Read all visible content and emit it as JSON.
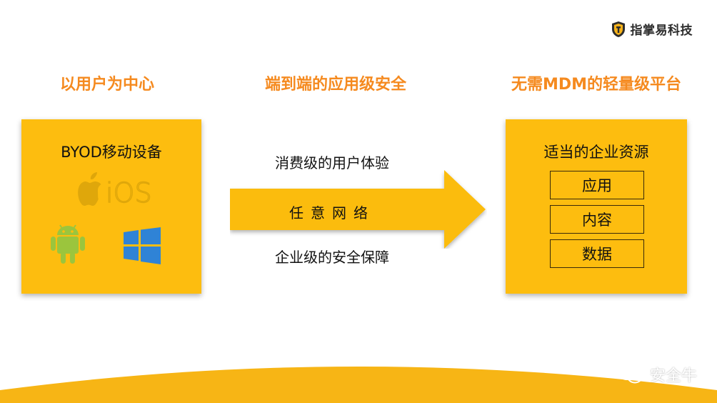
{
  "brand": {
    "name": "指掌易科技",
    "icon": "shield-logo-icon"
  },
  "headings": {
    "left": "以用户为中心",
    "center": "端到端的应用级安全",
    "right": "无需MDM的轻量级平台"
  },
  "left_box": {
    "title": "BYOD移动设备",
    "ios_label": "iOS",
    "icons": [
      "apple-ios-icon",
      "android-icon",
      "windows-icon"
    ]
  },
  "middle": {
    "top_text": "消费级的用户体验",
    "arrow_text": "任意网络",
    "bottom_text": "企业级的安全保障"
  },
  "right_box": {
    "title": "适当的企业资源",
    "items": [
      "应用",
      "内容",
      "数据"
    ]
  },
  "watermark": {
    "text": "安全牛",
    "icon": "wechat-icon"
  },
  "colors": {
    "accent_orange": "#f58a1f",
    "box_yellow": "#fdbd0f",
    "arrow_yellow": "#fbbc0c",
    "arc_yellow": "#f7b515"
  }
}
